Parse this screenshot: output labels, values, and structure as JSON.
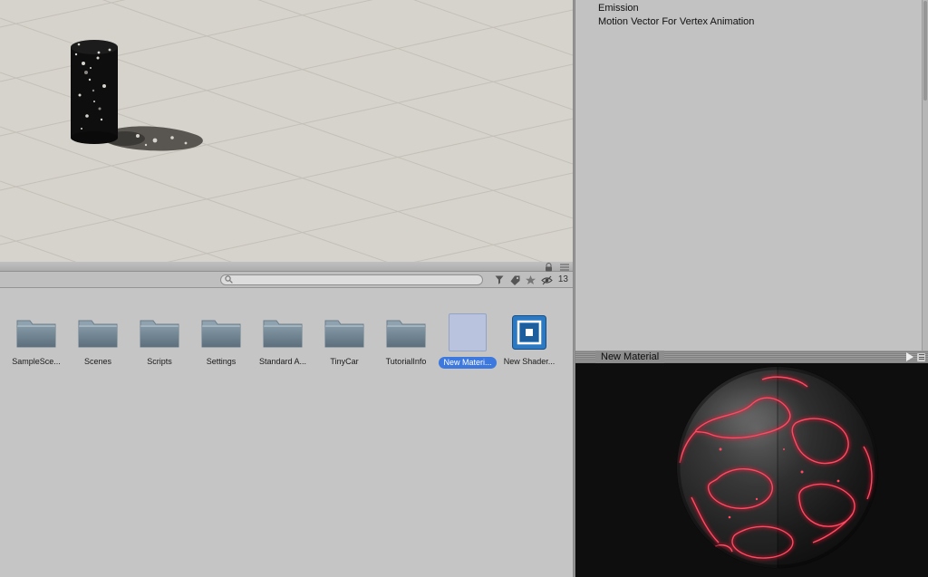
{
  "inspector": {
    "properties": [
      "Emission",
      "Motion Vector For Vertex Animation"
    ]
  },
  "project": {
    "search_placeholder": "",
    "hidden_count": "13",
    "items": [
      {
        "label": "SampleSce...",
        "type": "folder",
        "selected": false
      },
      {
        "label": "Scenes",
        "type": "folder",
        "selected": false
      },
      {
        "label": "Scripts",
        "type": "folder",
        "selected": false
      },
      {
        "label": "Settings",
        "type": "folder",
        "selected": false
      },
      {
        "label": "Standard A...",
        "type": "folder",
        "selected": false
      },
      {
        "label": "TinyCar",
        "type": "folder",
        "selected": false
      },
      {
        "label": "TutorialInfo",
        "type": "folder",
        "selected": false
      },
      {
        "label": "New Materi...",
        "type": "material",
        "selected": true
      },
      {
        "label": "New Shader...",
        "type": "shader",
        "selected": false
      }
    ]
  },
  "preview": {
    "title": "New Material"
  },
  "colors": {
    "selection_blue": "#3c78dd",
    "shader_blue": "#2a79c2",
    "emission_red": "#ff4a62",
    "panel_gray": "#c2c2c2",
    "scene_bg": "#d6d3cc"
  },
  "icons": {
    "search": "magnifier",
    "filter": "funnel",
    "label": "tag",
    "favorite": "star",
    "hidden": "eye-slash",
    "lock": "padlock",
    "menu": "hamburger-menu",
    "play": "triangle-right"
  }
}
